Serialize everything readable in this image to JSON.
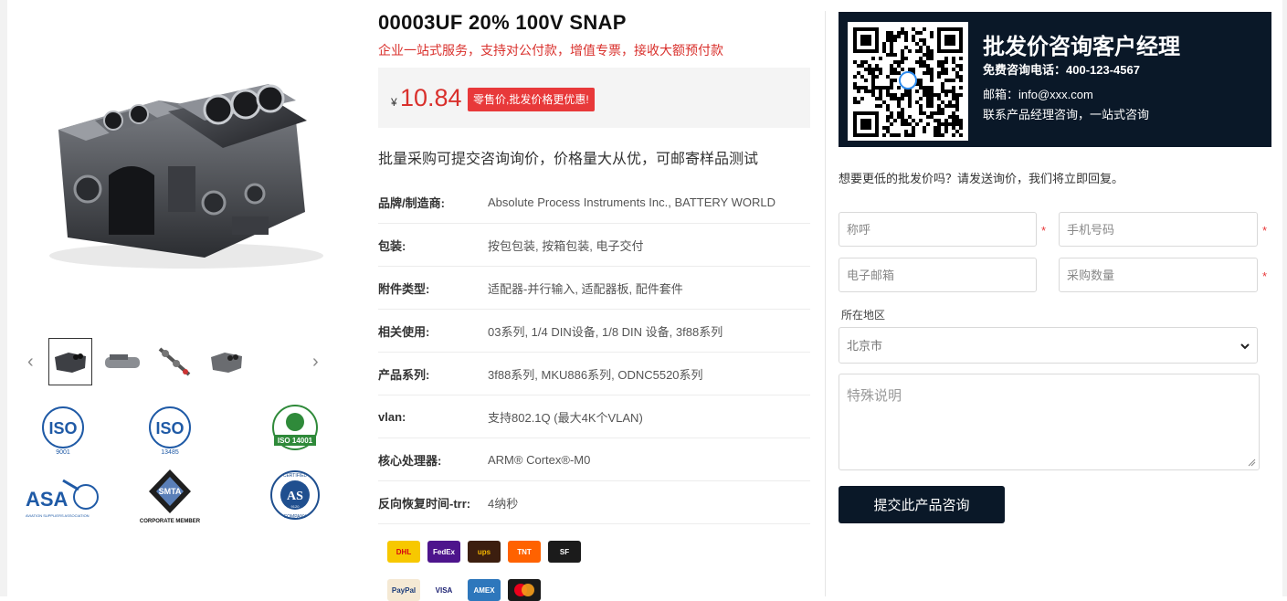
{
  "product": {
    "title": "00003UF 20% 100V SNAP",
    "subtitle": "企业一站式服务，支持对公付款，增值专票，接收大额预付款",
    "currency_symbol": "¥",
    "price": "10.84",
    "price_badge": "零售价,批发价格更优惠!",
    "description": "批量采购可提交咨询询价，价格量大从优，可邮寄样品测试",
    "specs": [
      {
        "label": "品牌/制造商:",
        "value": "Absolute Process Instruments Inc., BATTERY WORLD"
      },
      {
        "label": "包装:",
        "value": "按包包装, 按箱包装, 电子交付"
      },
      {
        "label": "附件类型:",
        "value": "适配器-并行输入, 适配器板, 配件套件"
      },
      {
        "label": "相关使用:",
        "value": "03系列, 1/4 DIN设备, 1/8 DIN 设备, 3f88系列"
      },
      {
        "label": "产品系列:",
        "value": "3f88系列, MKU886系列, ODNC5520系列"
      },
      {
        "label": "vlan:",
        "value": "支持802.1Q (最大4K个VLAN)"
      },
      {
        "label": "核心处理器:",
        "value": "ARM® Cortex®-M0"
      },
      {
        "label": "反向恢复时间-trr:",
        "value": "4纳秒"
      }
    ]
  },
  "certs": {
    "iso9001": {
      "main": "ISO",
      "sub": "9001"
    },
    "iso13485": {
      "main": "ISO",
      "sub": "13485"
    },
    "iso14001": {
      "main": "ISO 14001"
    },
    "asa": {
      "main": "ASA",
      "sub": "AVIATION SUPPLIERS ASSOCIATION"
    },
    "smta": {
      "main": "SMTA",
      "sub": "CORPORATE MEMBER"
    },
    "as9120": {
      "main": "AS",
      "sub": "CERTIFIED",
      "sub2": "COMPANY",
      "code": "9120"
    }
  },
  "shipping": [
    {
      "name": "dhl",
      "label": "DHL",
      "bg": "#f7c800",
      "fg": "#d40511"
    },
    {
      "name": "fedex",
      "label": "FedEx",
      "bg": "#4d148c",
      "fg": "#ffffff"
    },
    {
      "name": "ups",
      "label": "ups",
      "bg": "#3c1e0f",
      "fg": "#f5b700"
    },
    {
      "name": "tnt",
      "label": "TNT",
      "bg": "#ff6200",
      "fg": "#ffffff"
    },
    {
      "name": "sf",
      "label": "SF",
      "bg": "#1b1b1b",
      "fg": "#ffffff"
    }
  ],
  "payments": [
    {
      "name": "paypal",
      "label": "PayPal",
      "bg": "#f5e9d4",
      "fg": "#1b3c7a"
    },
    {
      "name": "visa",
      "label": "VISA",
      "bg": "#ffffff",
      "fg": "#1a1f71"
    },
    {
      "name": "amex",
      "label": "AMEX",
      "bg": "#2e77bc",
      "fg": "#ffffff"
    },
    {
      "name": "mastercard",
      "label": "",
      "bg": "#1a1a1a",
      "fg": "#ffffff"
    }
  ],
  "contact": {
    "title": "批发价咨询客户经理",
    "phone": "免费咨询电话：400-123-4567",
    "email": "邮箱：info@xxx.com",
    "note": "联系产品经理咨询，一站式咨询"
  },
  "form": {
    "question": "想要更低的批发价吗？请发送询价，我们将立即回复。",
    "name_placeholder": "称呼",
    "phone_placeholder": "手机号码",
    "email_placeholder": "电子邮箱",
    "qty_placeholder": "采购数量",
    "required_mark": "*",
    "region_label": "所在地区",
    "region_value": "北京市",
    "notes_placeholder": "特殊说明",
    "submit_label": "提交此产品咨询"
  },
  "colors": {
    "accent_red": "#d9302c",
    "dark_navy": "#0a1828"
  }
}
